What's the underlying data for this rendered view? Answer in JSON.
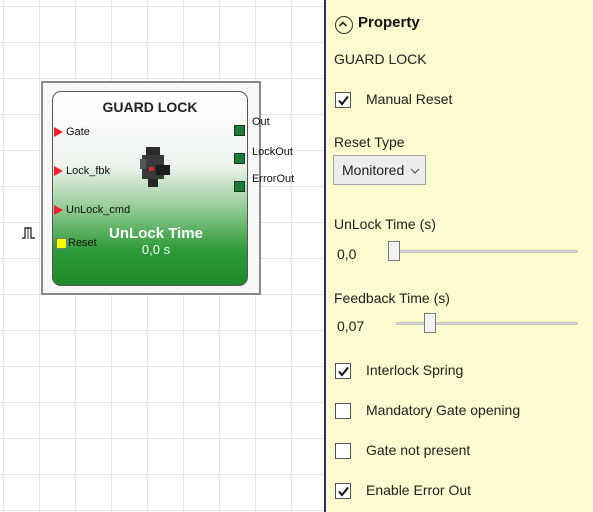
{
  "block": {
    "title": "GUARD LOCK",
    "inputs": [
      "Gate",
      "Lock_fbk",
      "UnLock_cmd"
    ],
    "reset_label": "Reset",
    "outputs": [
      "Out",
      "LockOut",
      "ErrorOut"
    ],
    "time_label": "UnLock Time",
    "time_value": "0,0 s"
  },
  "panel": {
    "header": "Property",
    "subtitle": "GUARD LOCK",
    "manual_reset": {
      "label": "Manual Reset",
      "checked": true
    },
    "reset_type": {
      "label": "Reset Type",
      "value": "Monitored"
    },
    "unlock_time": {
      "label": "UnLock Time (s)",
      "value": "0,0"
    },
    "feedback_time": {
      "label": "Feedback Time (s)",
      "value": "0,07"
    },
    "interlock_spring": {
      "label": "Interlock Spring",
      "checked": true
    },
    "mandatory_gate": {
      "label": "Mandatory Gate opening",
      "checked": false
    },
    "gate_not_present": {
      "label": "Gate not present",
      "checked": false
    },
    "enable_error_out": {
      "label": "Enable Error Out",
      "checked": true
    }
  },
  "colors": {
    "panel_bg": "#fbfbcf",
    "input_pin": "#ff1e2d",
    "output_pin": "#1f7a3a",
    "reset_pin": "#ffff00",
    "block_green": "#2d9a38"
  }
}
